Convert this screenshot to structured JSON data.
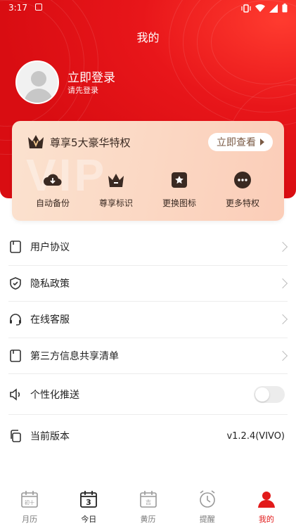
{
  "status_bar": {
    "time": "3:17"
  },
  "header": {
    "title": "我的"
  },
  "user": {
    "login_title": "立即登录",
    "login_subtitle": "请先登录"
  },
  "vip": {
    "title": "尊享5大豪华特权",
    "view_button": "立即查看",
    "watermark": "VIP",
    "perks": [
      {
        "label": "自动备份",
        "icon": "cloud-download-icon"
      },
      {
        "label": "尊享标识",
        "icon": "crown-icon"
      },
      {
        "label": "更换图标",
        "icon": "star-badge-icon"
      },
      {
        "label": "更多特权",
        "icon": "more-dots-icon"
      }
    ]
  },
  "menu": {
    "items": [
      {
        "label": "用户协议",
        "icon": "document-icon"
      },
      {
        "label": "隐私政策",
        "icon": "shield-icon"
      },
      {
        "label": "在线客服",
        "icon": "headset-icon"
      },
      {
        "label": "第三方信息共享清单",
        "icon": "document-icon"
      },
      {
        "label": "个性化推送",
        "icon": "speaker-icon",
        "toggle": false
      },
      {
        "label": "当前版本",
        "icon": "copy-icon",
        "value": "v1.2.4(VIVO)"
      }
    ]
  },
  "tabbar": {
    "tabs": [
      {
        "label": "月历",
        "icon": "calendar-month-icon",
        "glyph": "初十"
      },
      {
        "label": "今日",
        "icon": "calendar-today-icon",
        "glyph": "3"
      },
      {
        "label": "黄历",
        "icon": "almanac-icon",
        "glyph": "吉"
      },
      {
        "label": "提醒",
        "icon": "alarm-clock-icon"
      },
      {
        "label": "我的",
        "icon": "profile-icon",
        "active": true
      }
    ]
  },
  "colors": {
    "brand_red": "#e21b1b",
    "vip_gold_text": "#7a5a44"
  }
}
